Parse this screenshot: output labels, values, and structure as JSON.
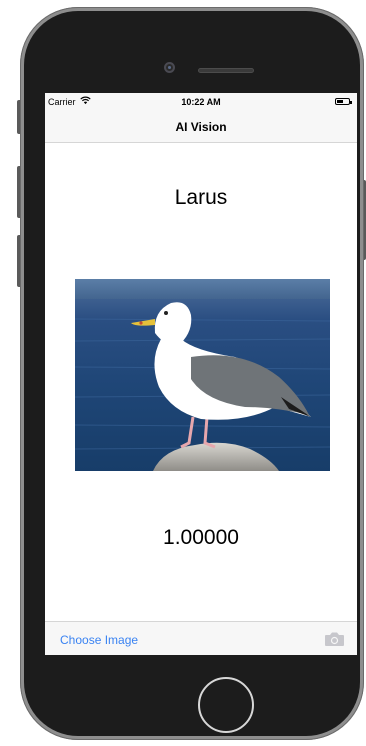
{
  "status_bar": {
    "carrier": "Carrier",
    "time": "10:22 AM",
    "wifi_icon": "wifi-icon",
    "battery_icon": "battery-icon"
  },
  "nav": {
    "title": "AI Vision"
  },
  "result": {
    "label": "Larus",
    "confidence": "1.00000"
  },
  "image": {
    "description_icon": "seagull-photo"
  },
  "toolbar": {
    "choose_image_label": "Choose Image",
    "camera_icon": "camera-icon"
  },
  "colors": {
    "tint": "#3a83f2",
    "bar_background": "#f7f7f7",
    "device_frame": "#1c1c1c"
  }
}
